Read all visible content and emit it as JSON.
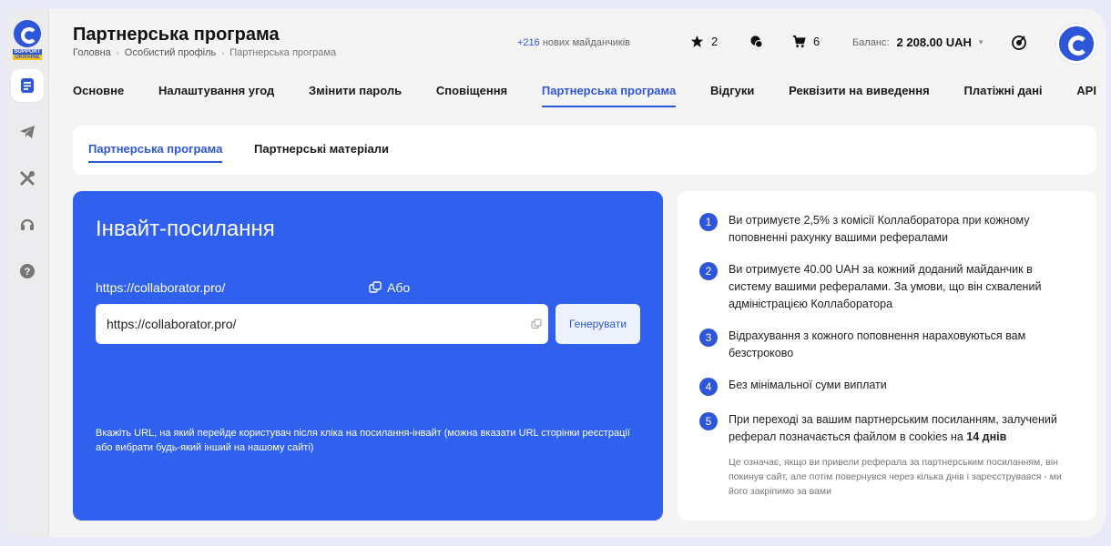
{
  "header": {
    "title": "Партнерська програма",
    "breadcrumb": [
      "Головна",
      "Особистий профіль",
      "Партнерська програма"
    ],
    "new_sites_count": "+216",
    "new_sites_text": "нових майданчиків",
    "favorites_count": "2",
    "messages_count": "",
    "cart_count": "6",
    "balance_label": "Баланс:",
    "balance_value": "2 208.00 UAH"
  },
  "logo": {
    "line1": "SUPPORT",
    "line2": "UKRAINE"
  },
  "tabs": [
    {
      "label": "Основне"
    },
    {
      "label": "Налаштування угод"
    },
    {
      "label": "Змінити пароль"
    },
    {
      "label": "Сповіщення"
    },
    {
      "label": "Партнерська програма",
      "active": true
    },
    {
      "label": "Відгуки"
    },
    {
      "label": "Реквізити на виведення"
    },
    {
      "label": "Платіжні дані"
    },
    {
      "label": "API"
    }
  ],
  "subtabs": [
    {
      "label": "Партнерська програма",
      "active": true
    },
    {
      "label": "Партнерські матеріали"
    }
  ],
  "invite": {
    "title": "Інвайт-посилання",
    "link": "https://collaborator.pro/",
    "or_label": "Або",
    "input_value": "https://collaborator.pro/",
    "generate_label": "Генерувати",
    "hint": "Вкажіть URL, на який перейде користувач після кліка на посилання-інвайт (можна вказати URL сторінки реєстрації або вибрати будь-який інший на нашому сайті)"
  },
  "info": {
    "items": [
      {
        "num": "1",
        "text": "Ви отримуєте 2,5% з комісії Коллаборатора при кожному поповненні рахунку вашими рефералами"
      },
      {
        "num": "2",
        "text": "Ви отримуєте 40.00 UAH за кожний доданий майданчик в систему вашими рефералами. За умови, що він схвалений адміністрацією Коллаборатора"
      },
      {
        "num": "3",
        "text": "Відрахування з кожного поповнення нараховуються вам безстроково"
      },
      {
        "num": "4",
        "text": "Без мінімальної суми виплати"
      },
      {
        "num": "5",
        "text": "При переході за вашим партнерським посиланням, залучений реферал позначається файлом в cookies на",
        "bold": "14 днів"
      }
    ],
    "note": "Це означає, якщо ви привели реферала за партнерським посиланням, він покинув сайт, але потім повернувся через кілька днів і зареєструвався - ми його закріпимо за вами"
  },
  "colors": {
    "accent": "#2e56d9",
    "invite_bg": "#3060ee"
  },
  "icons": [
    "document-icon",
    "telegram-icon",
    "tools-icon",
    "headset-icon",
    "help-icon",
    "star-icon",
    "chat-icon",
    "cart-icon",
    "radar-icon",
    "copy-icon"
  ]
}
